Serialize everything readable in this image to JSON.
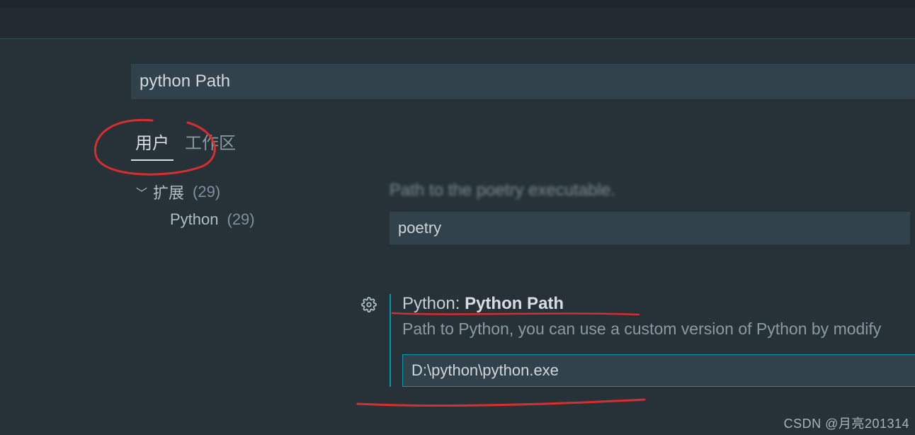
{
  "search": {
    "value": "python Path"
  },
  "tabs": {
    "user": "用户",
    "workspace": "工作区"
  },
  "sidebar": {
    "extensions_label": "扩展",
    "extensions_count": "(29)",
    "python_label": "Python",
    "python_count": "(29)"
  },
  "above": {
    "desc_blur": "Path to the poetry executable.",
    "poetry_value": "poetry"
  },
  "setting": {
    "group": "Python: ",
    "title": "Python Path",
    "desc": "Path to Python, you can use a custom version of Python by modify",
    "value": "D:\\python\\python.exe"
  },
  "watermark": "CSDN @月亮201314"
}
